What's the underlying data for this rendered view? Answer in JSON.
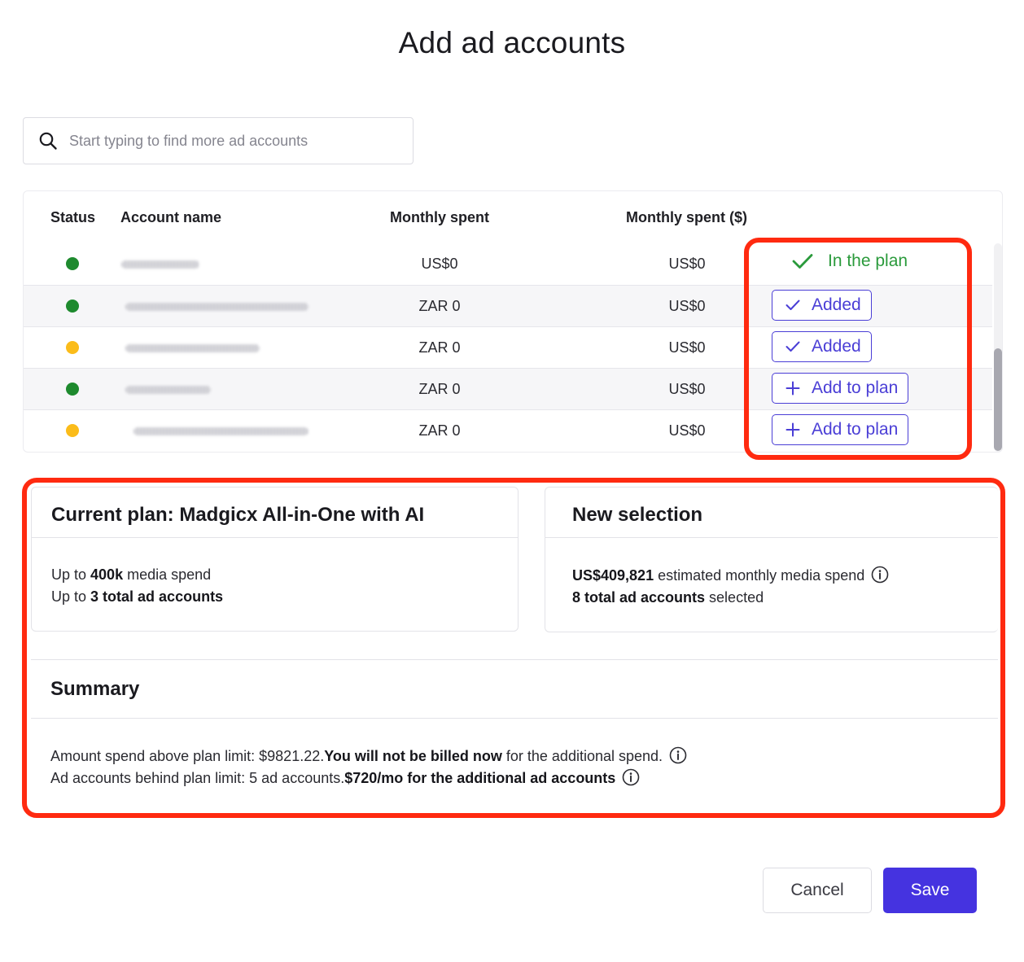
{
  "title": "Add ad accounts",
  "search": {
    "placeholder": "Start typing to find more ad accounts"
  },
  "table": {
    "headers": {
      "status": "Status",
      "account_name": "Account name",
      "monthly_spent": "Monthly spent",
      "monthly_spent_usd": "Monthly spent ($)"
    },
    "rows": [
      {
        "status": "green",
        "monthly_spent": "US$0",
        "monthly_spent_usd": "US$0",
        "action": "In the plan"
      },
      {
        "status": "green",
        "monthly_spent": "ZAR 0",
        "monthly_spent_usd": "US$0",
        "action": "Added"
      },
      {
        "status": "yellow",
        "monthly_spent": "ZAR 0",
        "monthly_spent_usd": "US$0",
        "action": "Added"
      },
      {
        "status": "green",
        "monthly_spent": "ZAR 0",
        "monthly_spent_usd": "US$0",
        "action": "Add to plan"
      },
      {
        "status": "yellow",
        "monthly_spent": "ZAR 0",
        "monthly_spent_usd": "US$0",
        "action": "Add to plan"
      }
    ]
  },
  "current_plan": {
    "title": "Current plan: Madgicx All-in-One with AI",
    "line1": {
      "prefix": "Up to ",
      "bold": "400k",
      "suffix": " media spend"
    },
    "line2": {
      "prefix": "Up to ",
      "bold": "3 total ad accounts"
    }
  },
  "new_selection": {
    "title": "New selection",
    "line1": {
      "bold": "US$409,821",
      "suffix": " estimated monthly media spend"
    },
    "line2": {
      "bold": "8 total ad accounts",
      "suffix": " selected"
    }
  },
  "summary": {
    "title": "Summary",
    "line1": {
      "prefix": "Amount spend above plan limit: $9821.22.",
      "bold": "You will not be billed now",
      "suffix": " for the additional spend."
    },
    "line2": {
      "prefix": "Ad accounts behind plan limit: 5 ad accounts.",
      "bold": "$720/mo for the additional ad accounts"
    }
  },
  "buttons": {
    "cancel": "Cancel",
    "save": "Save"
  },
  "colors": {
    "accent": "#4533e0",
    "status_green": "#1e8a2e",
    "status_yellow": "#fbbc1a",
    "in_plan_green": "#2a9a3b",
    "highlight": "#ff2a10"
  },
  "icons": {
    "search": "search-icon",
    "check": "check-icon",
    "plus": "plus-icon",
    "info": "info-icon"
  }
}
